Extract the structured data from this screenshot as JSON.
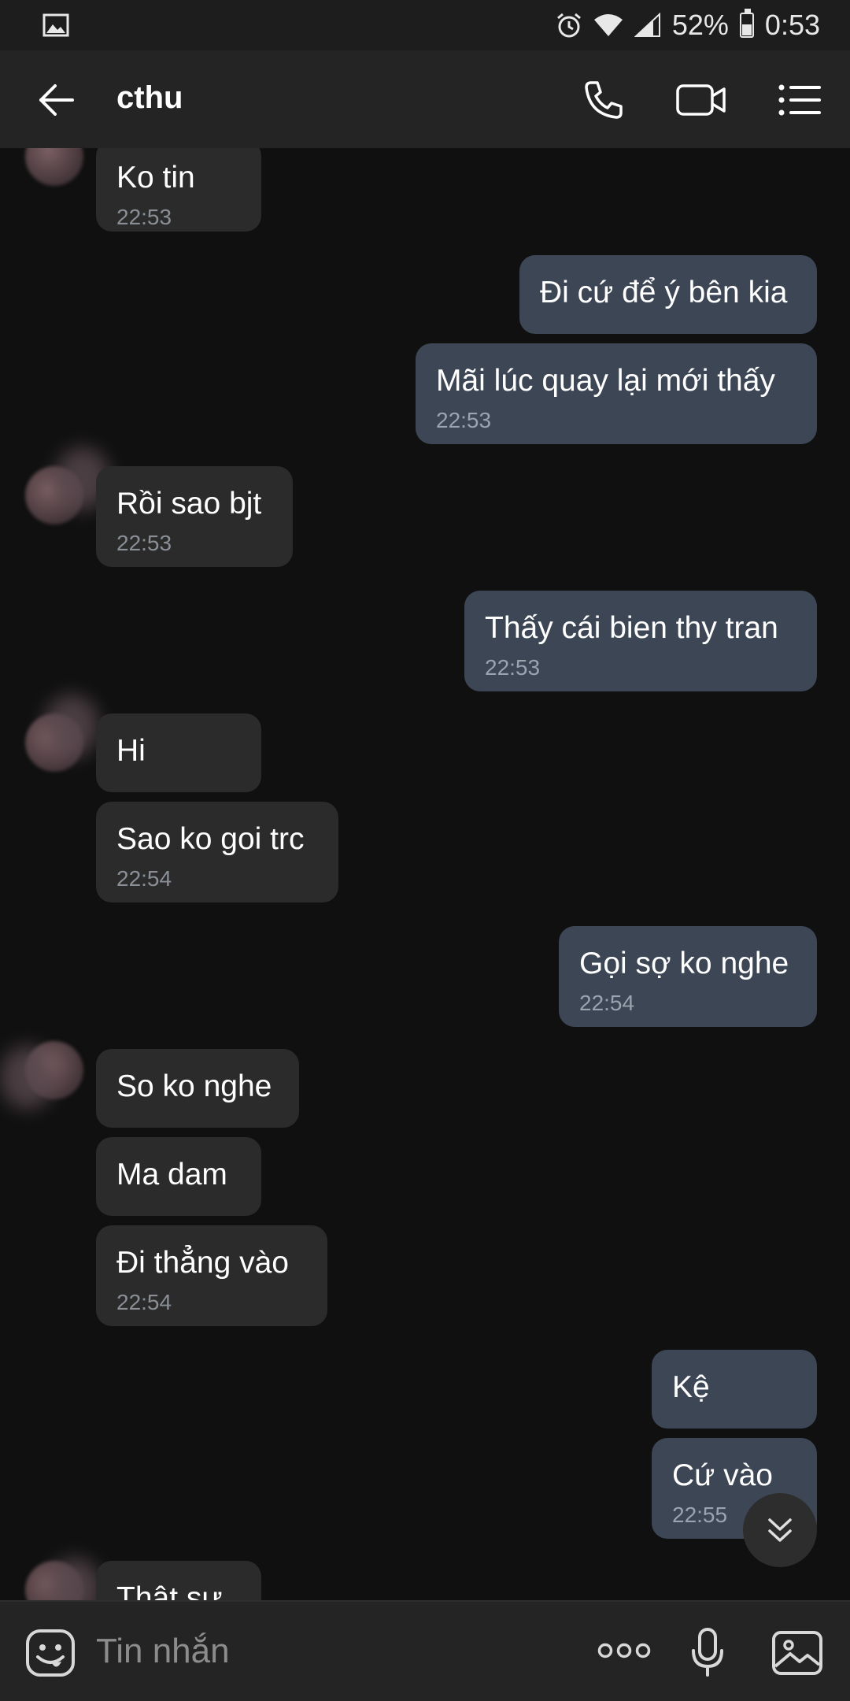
{
  "status_bar": {
    "battery": "52%",
    "time": "0:53",
    "icons": [
      "image-icon",
      "alarm-icon",
      "wifi-icon",
      "signal-icon",
      "battery-icon"
    ]
  },
  "header": {
    "title": "cthu",
    "actions": [
      "back-arrow-icon",
      "phone-icon",
      "video-call-icon",
      "menu-list-icon"
    ]
  },
  "messages": [
    {
      "side": "in",
      "text": "Ko tin",
      "time": "22:53"
    },
    {
      "side": "out",
      "text": "Đi cứ để ý bên kia",
      "time": ""
    },
    {
      "side": "out",
      "text": "Mãi lúc quay lại mới thấy",
      "time": "22:53"
    },
    {
      "side": "in",
      "text": "Rồi sao bjt",
      "time": "22:53"
    },
    {
      "side": "out",
      "text": "Thấy cái bien thy tran",
      "time": "22:53"
    },
    {
      "side": "in",
      "text": "Hi",
      "time": ""
    },
    {
      "side": "in",
      "text": "Sao ko goi trc",
      "time": "22:54"
    },
    {
      "side": "out",
      "text": "Gọi sợ ko nghe",
      "time": "22:54"
    },
    {
      "side": "in",
      "text": "So ko nghe",
      "time": ""
    },
    {
      "side": "in",
      "text": "Ma dam",
      "time": ""
    },
    {
      "side": "in",
      "text": "Đi thẳng vào",
      "time": "22:54"
    },
    {
      "side": "out",
      "text": "Kệ",
      "time": ""
    },
    {
      "side": "out",
      "text": "Cứ vào",
      "time": "22:55"
    },
    {
      "side": "in",
      "text": "Thật sự",
      "time": ""
    }
  ],
  "composer": {
    "placeholder": "Tin nhắn",
    "icons": [
      "emoji-icon",
      "more-options-icon",
      "microphone-icon",
      "gallery-icon"
    ]
  },
  "colors": {
    "background": "#101010",
    "bar": "#242424",
    "incoming_bubble": "#2b2b2b",
    "outgoing_bubble": "#3c4654",
    "timestamp": "#8a8f96"
  }
}
